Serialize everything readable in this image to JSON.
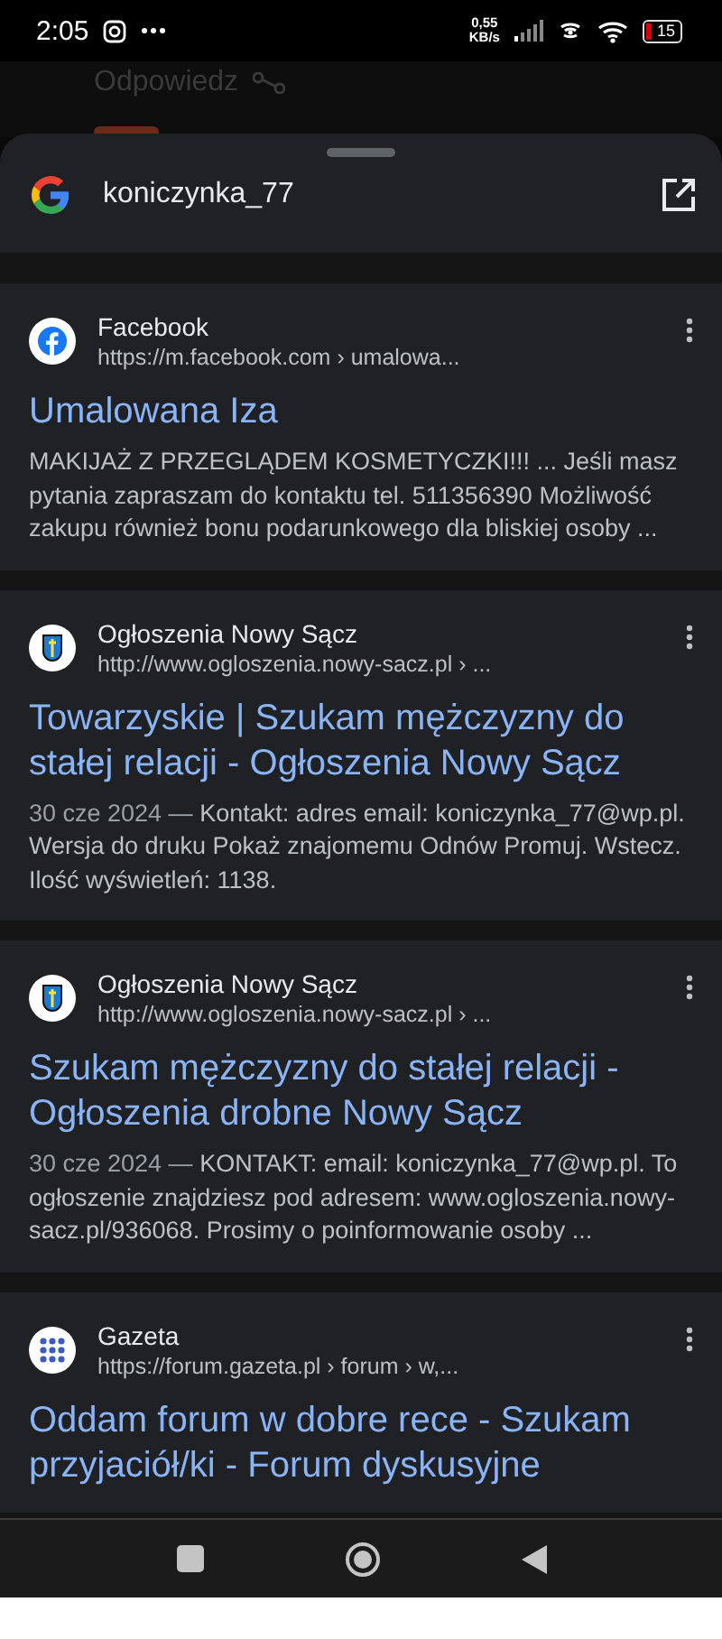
{
  "status_bar": {
    "time": "2:05",
    "speed": "0,55",
    "speed_unit": "KB/s",
    "battery": "15"
  },
  "background": {
    "text": "Odpowiedz"
  },
  "search": {
    "query": "koniczynka_77"
  },
  "results": [
    {
      "kind": "facebook",
      "site": "Facebook",
      "url": "https://m.facebook.com › umalowa...",
      "title": "Umalowana Iza",
      "snippet": "MAKIJAŻ Z PRZEGLĄDEM KOSMETYCZKI!!! ... Jeśli masz pytania zapraszam do kontaktu tel. 511356390 Możliwość zakupu również bonu podarunkowego dla bliskiej osoby ..."
    },
    {
      "kind": "crest",
      "site": "Ogłoszenia Nowy Sącz",
      "url": "http://www.ogloszenia.nowy-sacz.pl › ...",
      "title": "Towarzyskie | Szukam mężczyzny do stałej relacji - Ogłoszenia Nowy Sącz",
      "date": "30 cze 2024 — ",
      "snippet": "Kontakt: adres email: koniczynka_77@wp.pl. Wersja do druku Pokaż znajomemu Odnów Promuj. Wstecz. Ilość wyświetleń: 1138."
    },
    {
      "kind": "crest",
      "site": "Ogłoszenia Nowy Sącz",
      "url": "http://www.ogloszenia.nowy-sacz.pl › ...",
      "title": "Szukam mężczyzny do stałej relacji - Ogłoszenia drobne Nowy Sącz",
      "date": "30 cze 2024 — ",
      "snippet": "KONTAKT: email: koniczynka_77@wp.pl. To ogłoszenie znajdziesz pod adresem: www.ogloszenia.nowy-sacz.pl/936068. Prosimy o poinformowanie osoby ..."
    },
    {
      "kind": "dots",
      "site": "Gazeta",
      "url": "https://forum.gazeta.pl › forum › w,...",
      "title": "Oddam forum w dobre rece - Szukam przyjaciół/ki - Forum dyskusyjne"
    }
  ]
}
